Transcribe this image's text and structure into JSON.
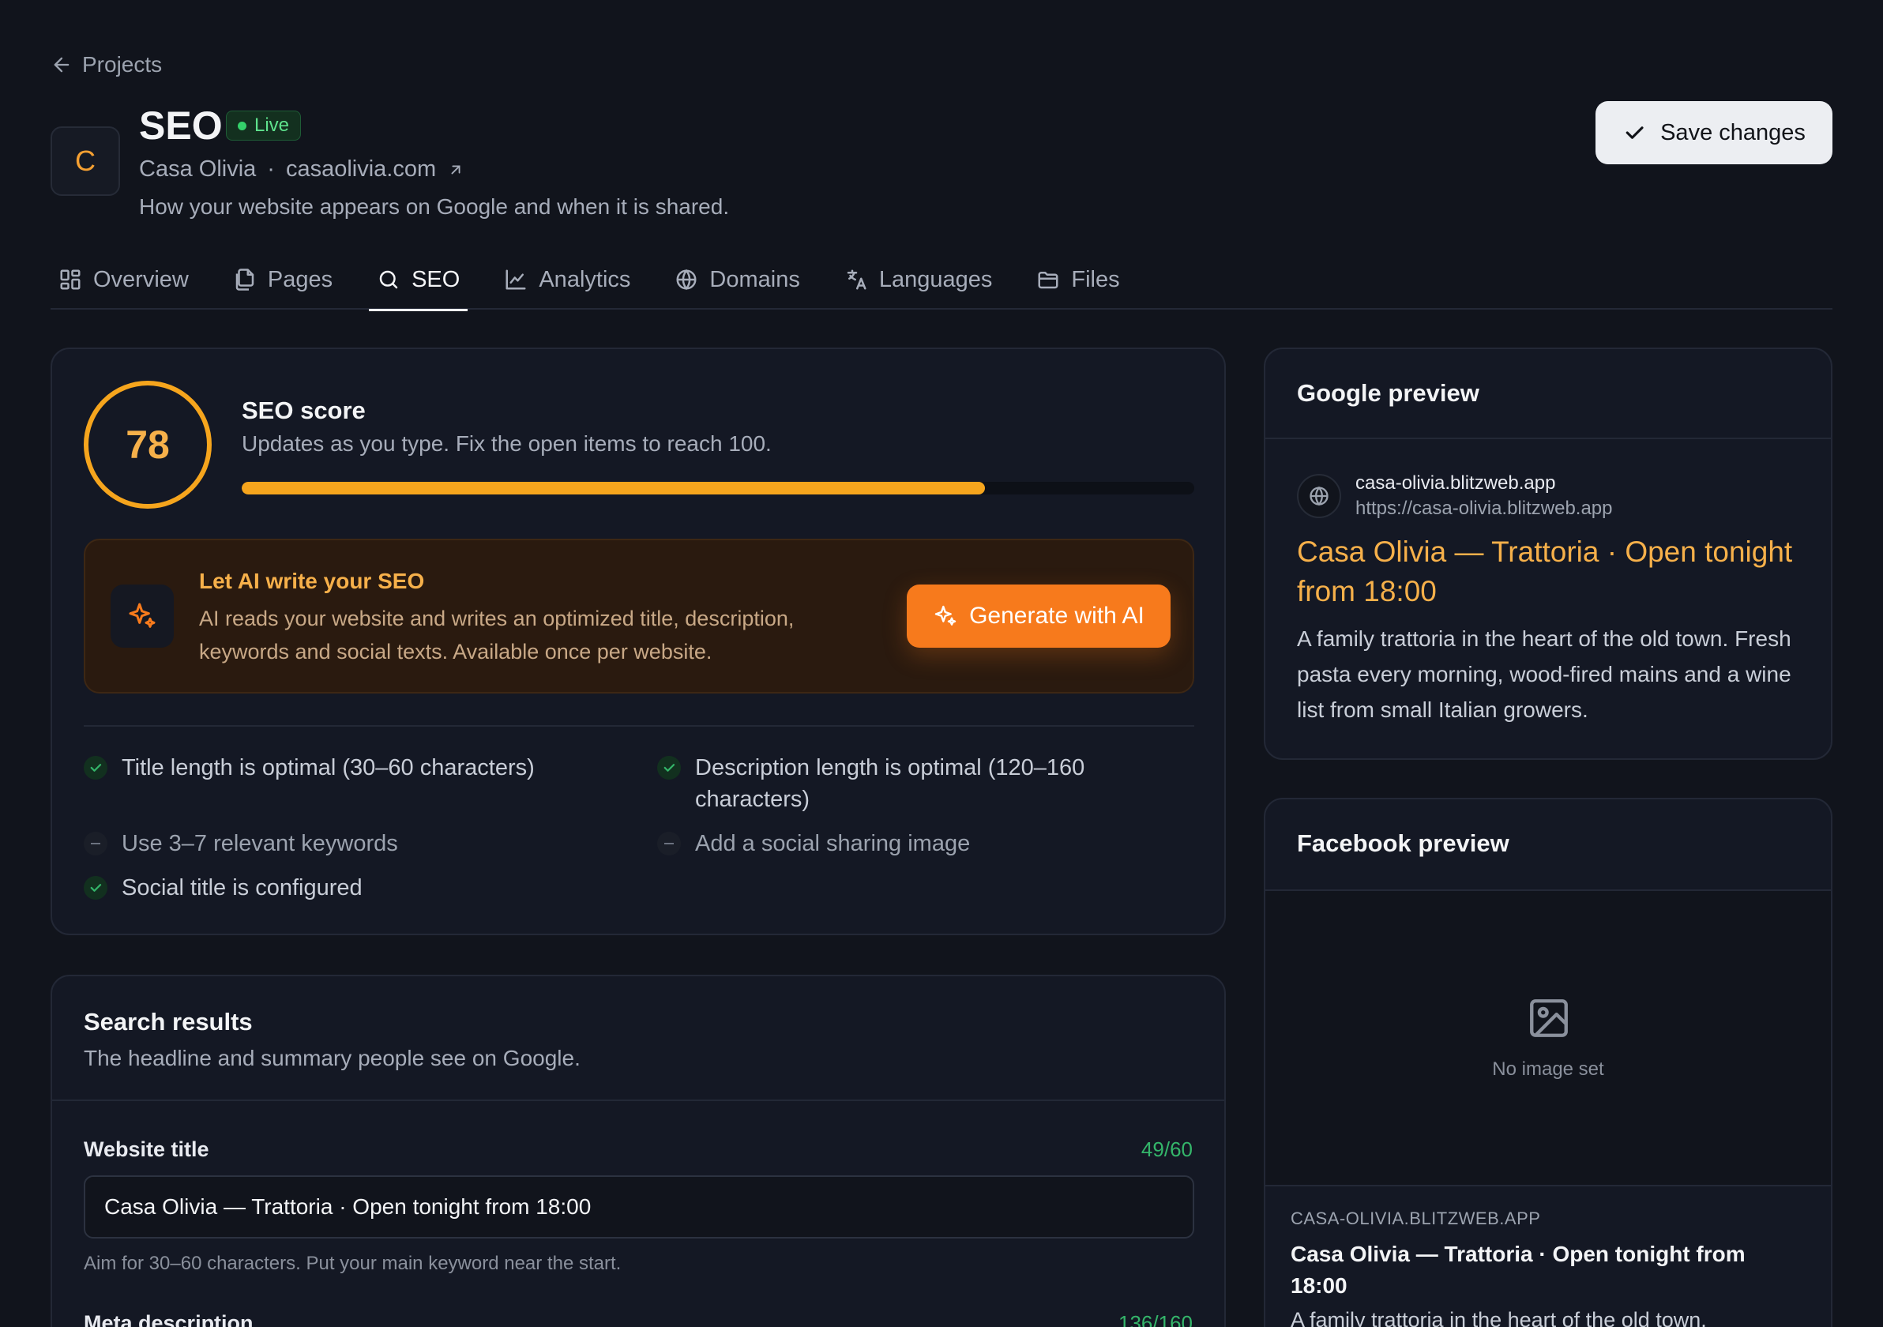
{
  "back_link": {
    "label": "Projects"
  },
  "project": {
    "avatar_letter": "C",
    "title": "SEO",
    "status": "Live",
    "name": "Casa Olivia",
    "separator": "·",
    "domain": "casaolivia.com",
    "description": "How your website appears on Google and when it is shared."
  },
  "save_button": {
    "label": "Save changes"
  },
  "tabs": [
    {
      "label": "Overview",
      "icon": "grid-icon"
    },
    {
      "label": "Pages",
      "icon": "pages-icon"
    },
    {
      "label": "SEO",
      "icon": "search-icon",
      "active": true
    },
    {
      "label": "Analytics",
      "icon": "chart-icon"
    },
    {
      "label": "Domains",
      "icon": "globe-icon"
    },
    {
      "label": "Languages",
      "icon": "translate-icon"
    },
    {
      "label": "Files",
      "icon": "folder-icon"
    }
  ],
  "score": {
    "value": "78",
    "progress_fraction": 0.78,
    "title": "SEO score",
    "subtitle": "Updates as you type. Fix the open items to reach 100."
  },
  "ai": {
    "title": "Let AI write your SEO",
    "text": "AI reads your website and writes an optimized title, description, keywords and social texts. Available once per website.",
    "button": "Generate with AI"
  },
  "checks": [
    {
      "label": "Title length is optimal (30–60 characters)",
      "ok": true
    },
    {
      "label": "Description length is optimal (120–160 characters)",
      "ok": true
    },
    {
      "label": "Use 3–7 relevant keywords",
      "ok": false
    },
    {
      "label": "Add a social sharing image",
      "ok": false
    },
    {
      "label": "Social title is configured",
      "ok": true
    }
  ],
  "search_results": {
    "title": "Search results",
    "subtitle": "The headline and summary people see on Google.",
    "website_title_label": "Website title",
    "website_title_count": "49/60",
    "website_title_value": "Casa Olivia — Trattoria · Open tonight from 18:00",
    "website_title_hint": "Aim for 30–60 characters. Put your main keyword near the start.",
    "meta_label": "Meta description",
    "meta_count": "136/160"
  },
  "google_preview": {
    "heading": "Google preview",
    "site": "casa-olivia.blitzweb.app",
    "url": "https://casa-olivia.blitzweb.app",
    "title": "Casa Olivia — Trattoria · Open tonight from 18:00",
    "description": "A family trattoria in the heart of the old town. Fresh pasta every morning, wood-fired mains and a wine list from small Italian growers."
  },
  "facebook_preview": {
    "heading": "Facebook preview",
    "no_image": "No image set",
    "domain": "CASA-OLIVIA.BLITZWEB.APP",
    "title": "Casa Olivia — Trattoria · Open tonight from 18:00",
    "description": "A family trattoria in the heart of the old town."
  },
  "colors": {
    "background": "#11141c",
    "card": "#141824",
    "accent_orange": "#f77a1c",
    "score_ring": "#f6a51d",
    "success_green": "#34b56a"
  }
}
